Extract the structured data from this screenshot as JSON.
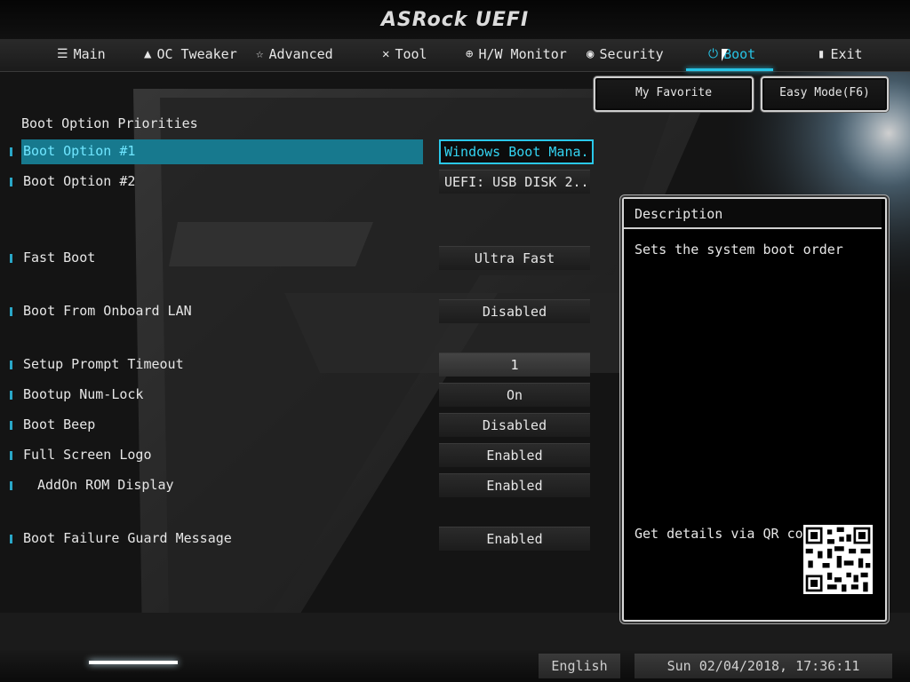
{
  "header": {
    "brand": "ASRock UEFI"
  },
  "tabs": [
    {
      "label": "Main",
      "icon": "list-icon"
    },
    {
      "label": "OC Tweaker",
      "icon": "rocket-icon"
    },
    {
      "label": "Advanced",
      "icon": "star-icon"
    },
    {
      "label": "Tool",
      "icon": "wrench-icon"
    },
    {
      "label": "H/W Monitor",
      "icon": "crosshair-icon"
    },
    {
      "label": "Security",
      "icon": "shield-icon"
    },
    {
      "label": "Boot",
      "icon": "power-icon"
    },
    {
      "label": "Exit",
      "icon": "door-icon"
    }
  ],
  "active_tab": "Boot",
  "top_buttons": {
    "favorite": "My Favorite",
    "easy_mode": "Easy Mode(F6)"
  },
  "section_title": "Boot Option Priorities",
  "options": [
    {
      "label": "Boot Option #1",
      "value": "Windows Boot Mana..."
    },
    {
      "label": "Boot Option #2",
      "value": "UEFI:  USB DISK 2..."
    },
    {
      "label": "Fast Boot",
      "value": "Ultra Fast"
    },
    {
      "label": "Boot From Onboard LAN",
      "value": "Disabled"
    },
    {
      "label": "Setup Prompt Timeout",
      "value": "1"
    },
    {
      "label": "Bootup Num-Lock",
      "value": "On"
    },
    {
      "label": "Boot Beep",
      "value": "Disabled"
    },
    {
      "label": "Full Screen Logo",
      "value": "Enabled"
    },
    {
      "label": "AddOn ROM Display",
      "value": "Enabled"
    },
    {
      "label": "Boot Failure Guard Message",
      "value": "Enabled"
    }
  ],
  "description": {
    "title": "Description",
    "text": "Sets the system boot order",
    "qr_text": "Get details via QR code"
  },
  "footer": {
    "language": "English",
    "datetime": "Sun 02/04/2018, 17:36:11"
  },
  "colors": {
    "accent": "#27c4e6",
    "selection": "#17798e",
    "background": "#0b0b0b"
  }
}
